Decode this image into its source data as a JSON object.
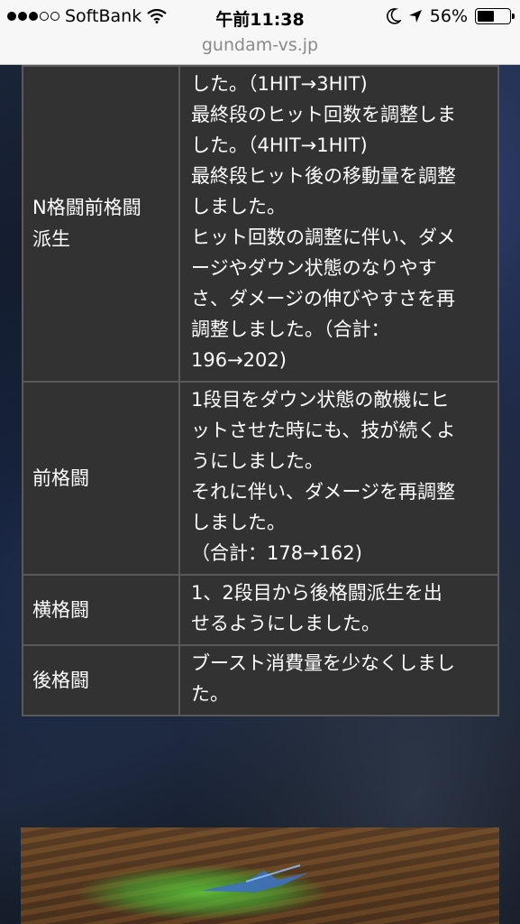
{
  "status_bar": {
    "carrier": "SoftBank",
    "time": "午前11:38",
    "battery_percent": "56%",
    "battery_level": 0.56,
    "signal_filled": 3,
    "signal_total": 5
  },
  "url_bar": {
    "domain": "gundam-vs.jp"
  },
  "table": {
    "rows": [
      {
        "name_lines": [
          "N格闘前格闘",
          "派生"
        ],
        "desc_lines": [
          "した。（1HIT→3HIT)",
          "最終段のヒット回数を調整しま",
          "した。（4HIT→1HIT)",
          "最終段ヒット後の移動量を調整",
          "しました。",
          "ヒット回数の調整に伴い、ダメ",
          "ージやダウン状態のなりやす",
          "さ、ダメージの伸びやすさを再",
          "調整しました。（合計：",
          "196→202)"
        ]
      },
      {
        "name_lines": [
          "前格闘"
        ],
        "desc_lines": [
          "1段目をダウン状態の敵機にヒ",
          "ットさせた時にも、技が続くよ",
          "うにしました。",
          "それに伴い、ダメージを再調整",
          "しました。",
          "（合計：178→162)"
        ]
      },
      {
        "name_lines": [
          "横格闘"
        ],
        "desc_lines": [
          "1、2段目から後格闘派生を出",
          "せるようにしました。"
        ]
      },
      {
        "name_lines": [
          "後格闘"
        ],
        "desc_lines": [
          "ブースト消費量を少なくしまし",
          "た。"
        ]
      }
    ]
  }
}
